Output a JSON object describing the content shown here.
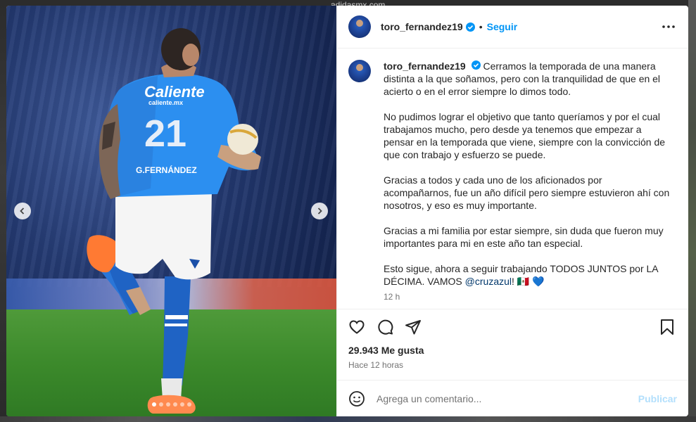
{
  "background": {
    "top_text": "adidasmx.com"
  },
  "post": {
    "username": "toro_fernandez19",
    "follow_label": "Seguir",
    "verified_color": "#0095f6",
    "caption": {
      "username": "toro_fernandez19",
      "p1": "Cerramos la temporada de una manera distinta a la que soñamos, pero con la tranquilidad de que en el acierto o en el error siempre lo dimos todo.",
      "p2": "No pudimos lograr el objetivo que tanto queríamos y por el cual trabajamos mucho, pero desde ya tenemos que empezar a pensar en la temporada que viene, siempre con la convicción de que con trabajo y esfuerzo se puede.",
      "p3": "Gracias a todos y cada uno de los aficionados por acompañarnos, fue un año difícil pero siempre estuvieron ahí con nosotros, y eso es muy importante.",
      "p4": "Gracias a mi familia por estar siempre, sin duda que fueron muy importantes para mi en este año tan especial.",
      "p5_text": "Esto sigue, ahora a seguir trabajando TODOS JUNTOS por LA DÉCIMA. VAMOS ",
      "p5_mention": "@cruzazul",
      "p5_end": "! 🇲🇽 💙",
      "time": "12 h"
    },
    "likes": "29.943 Me gusta",
    "posted_ago": "Hace 12 horas",
    "comment": {
      "placeholder": "Agrega un comentario...",
      "value": "",
      "publish_label": "Publicar"
    },
    "media": {
      "carousel_dots": 6,
      "active_dot": 0,
      "jersey_number": "21",
      "jersey_sponsor": "Caliente",
      "jersey_sponsor_url": "caliente.mx",
      "jersey_name": "G.FERNÁNDEZ"
    },
    "icons": [
      "more-options-icon",
      "heart-icon",
      "comment-icon",
      "share-icon",
      "bookmark-icon",
      "emoji-icon",
      "chevron-left-icon",
      "chevron-right-icon"
    ]
  }
}
